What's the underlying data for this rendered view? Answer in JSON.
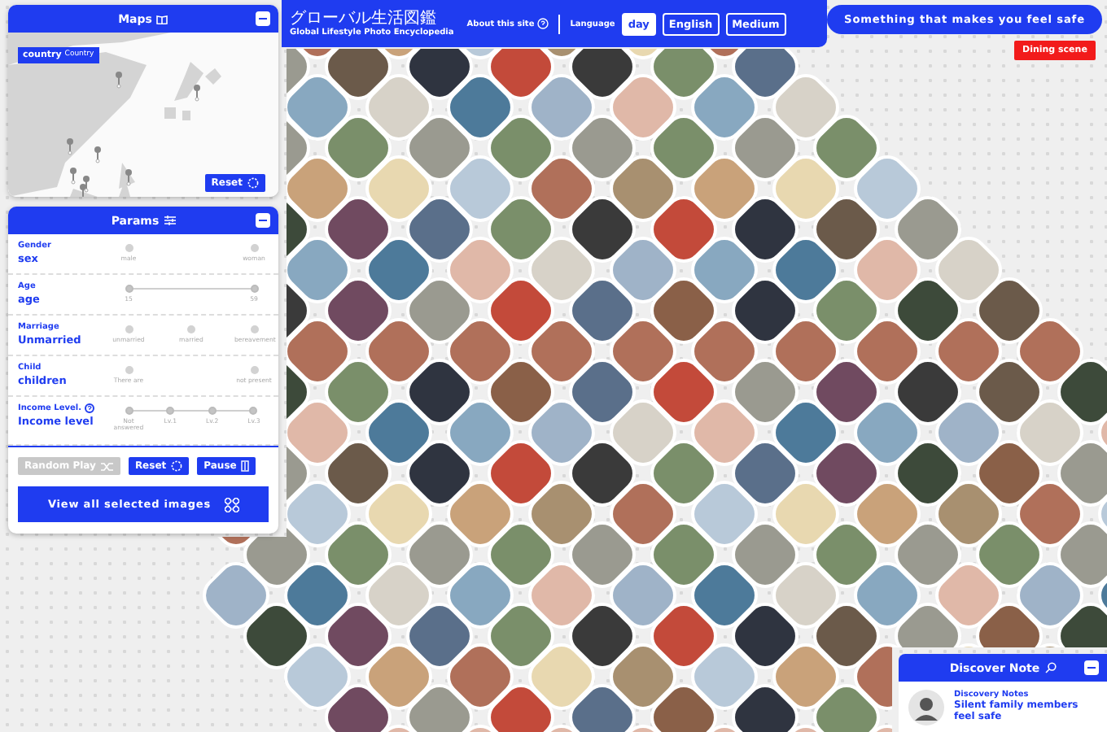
{
  "maps_panel": {
    "title": "Maps",
    "country_tag": {
      "label": "country",
      "sub": "Country"
    },
    "reset": "Reset"
  },
  "params_panel": {
    "title": "Params",
    "rows": [
      {
        "label": "Gender",
        "value": "sex",
        "help": false,
        "options": [
          {
            "label": "male",
            "selected": false
          },
          {
            "label": "woman",
            "selected": false
          }
        ]
      },
      {
        "label": "Age",
        "value": "age",
        "help": false,
        "options": [
          {
            "label": "15",
            "selected": true
          },
          {
            "label": "59",
            "selected": true
          }
        ]
      },
      {
        "label": "Marriage",
        "value": "Unmarried",
        "help": false,
        "options": [
          {
            "label": "unmarried",
            "selected": false
          },
          {
            "label": "married",
            "selected": false
          },
          {
            "label": "bereavement",
            "selected": false
          }
        ]
      },
      {
        "label": "Child",
        "value": "children",
        "help": false,
        "options": [
          {
            "label": "There are",
            "selected": false
          },
          {
            "label": "not present",
            "selected": false
          }
        ]
      },
      {
        "label": "Income Level.",
        "value": "Income level",
        "help": true,
        "options": [
          {
            "label": "Not answered",
            "selected": true
          },
          {
            "label": "Lv.1",
            "selected": true
          },
          {
            "label": "Lv.2",
            "selected": true
          },
          {
            "label": "Lv.3",
            "selected": true
          }
        ]
      }
    ],
    "buttons": [
      {
        "label": "Random Play",
        "disabled": true,
        "kind": "shuffle"
      },
      {
        "label": "Reset",
        "disabled": false,
        "kind": "reset"
      },
      {
        "label": "Pause",
        "disabled": false,
        "kind": "pause"
      }
    ],
    "view_all": "View all selected images"
  },
  "header": {
    "title_ja": "グローバル生活図鑑",
    "title_en": "Global Lifestyle Photo Encyclopedia",
    "about": "About this site",
    "language_label": "Language",
    "toggles": [
      {
        "label": "day",
        "selected": true
      },
      {
        "label": "English",
        "selected": false
      },
      {
        "label": "Medium",
        "selected": false
      }
    ]
  },
  "theme_button": "Something that makes you feel safe",
  "scene_tag": "Dining scene",
  "discover_panel": {
    "title": "Discover Note",
    "note_label": "Discovery Notes",
    "note_title": "Silent family members feel safe"
  }
}
